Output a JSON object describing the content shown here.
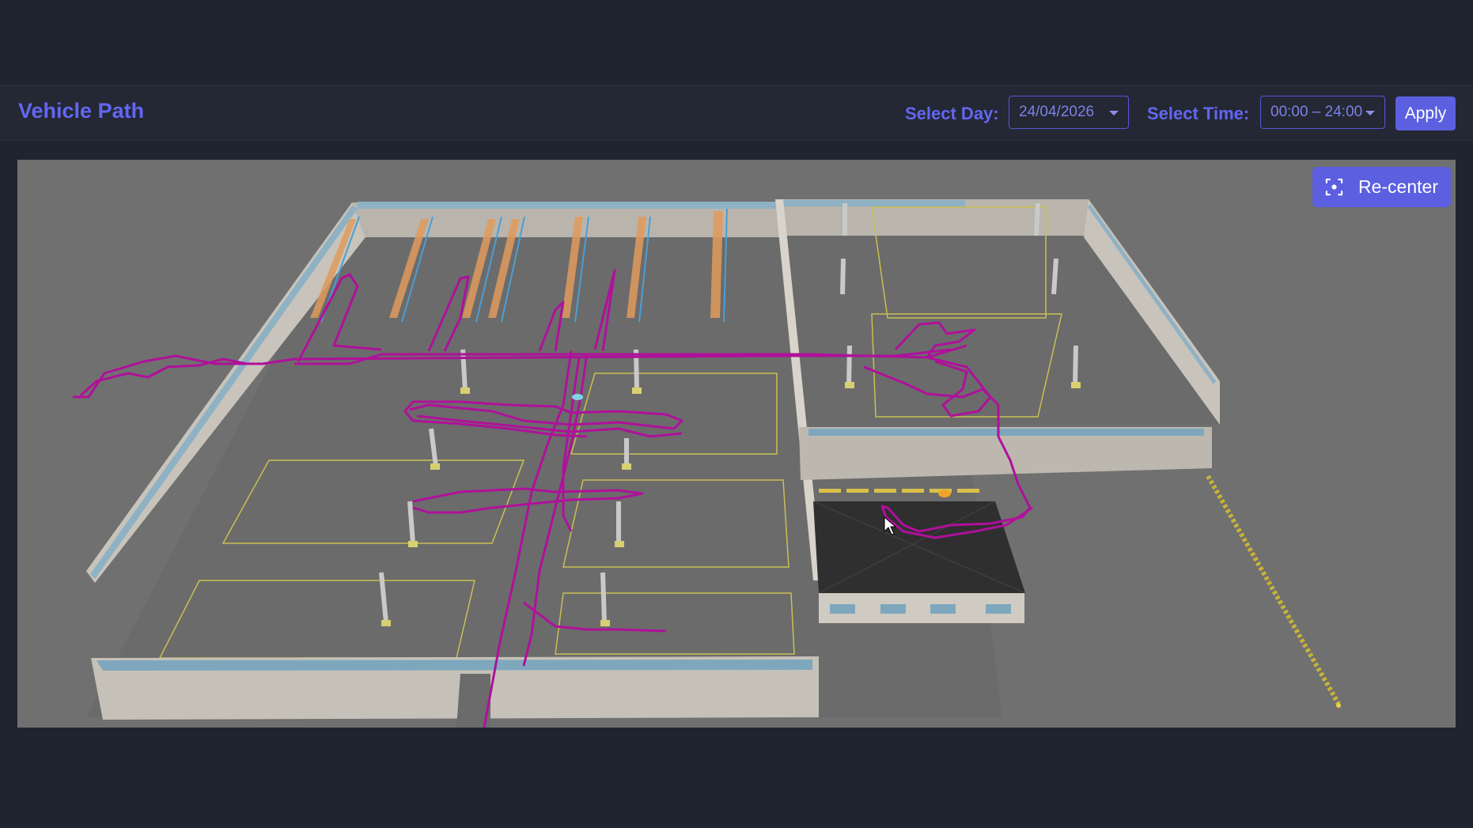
{
  "header": {
    "title": "Vehicle Path",
    "select_day_label": "Select Day:",
    "select_day_value": "24/04/2026",
    "select_time_label": "Select Time:",
    "select_time_value": "00:00 – 24:00",
    "apply_label": "Apply"
  },
  "viewport": {
    "recenter_label": "Re-center",
    "recenter_icon": "focus-icon",
    "path_color": "#b0109b",
    "floor_color": "#6b6b6b",
    "ground_color": "#707070"
  }
}
